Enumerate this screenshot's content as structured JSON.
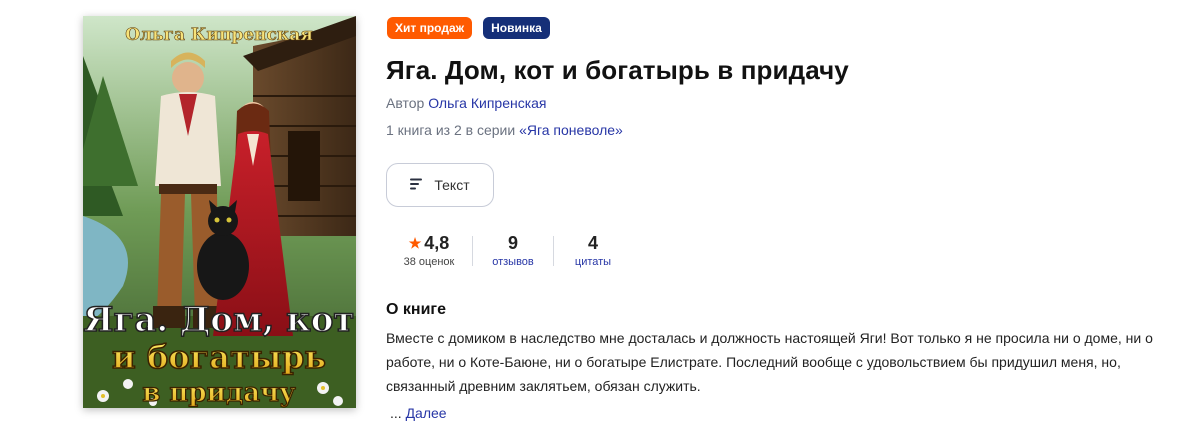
{
  "book": {
    "cover": {
      "author_text": "Ольга Кипренская",
      "title_line1": "Яга. Дом, кот",
      "title_line2": "и богатырь",
      "title_line3": "в придачу"
    },
    "badges": {
      "hit": "Хит продаж",
      "new": "Новинка"
    },
    "title": "Яга. Дом, кот и богатырь в придачу",
    "author_label": "Автор",
    "author_name": "Ольга Кипренская",
    "series_prefix": "1 книга из 2 в серии",
    "series_name": "«Яга поневоле»",
    "format_button": "Текст",
    "stats": {
      "rating": "4,8",
      "rating_label": "38 оценок",
      "reviews": "9",
      "reviews_label": "отзывов",
      "quotes": "4",
      "quotes_label": "цитаты"
    },
    "about_heading": "О книге",
    "description": "Вместе с домиком в наследство мне досталась и должность настоящей Яги! Вот только я не просила ни о доме, ни о работе, ни о Коте-Баюне, ни о богатыре Елистрате. Последний вообще с удовольствием бы придушил меня, но, связанный древним заклятьем, обязан служить.",
    "more_dots": "...",
    "more_label": "Далее"
  },
  "colors": {
    "accent_orange": "#ff5a00",
    "badge_navy": "#152f78",
    "link_blue": "#2736a6"
  },
  "icons": {
    "format": "text-lines-icon",
    "rating": "star-icon"
  }
}
